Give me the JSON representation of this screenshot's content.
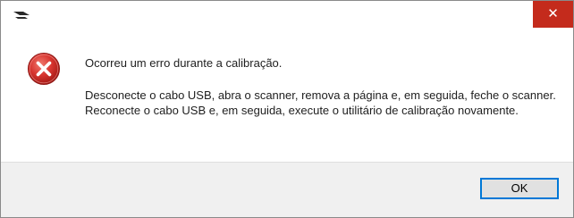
{
  "dialog": {
    "close_glyph": "✕",
    "message_title": "Ocorreu um erro durante a calibração.",
    "message_body": "Desconecte o cabo USB, abra o scanner, remova a página e, em seguida, feche o scanner.\nReconecte o cabo USB e, em seguida, execute o utilitário de calibração novamente.",
    "ok_label": "OK"
  },
  "icons": {
    "app": "scanner-app-icon",
    "error": "error-icon",
    "close": "close-icon"
  },
  "colors": {
    "close_background": "#c42b1c",
    "error_red": "#d7342f",
    "button_focus_border": "#0078d7",
    "footer_background": "#f0f0f0"
  }
}
